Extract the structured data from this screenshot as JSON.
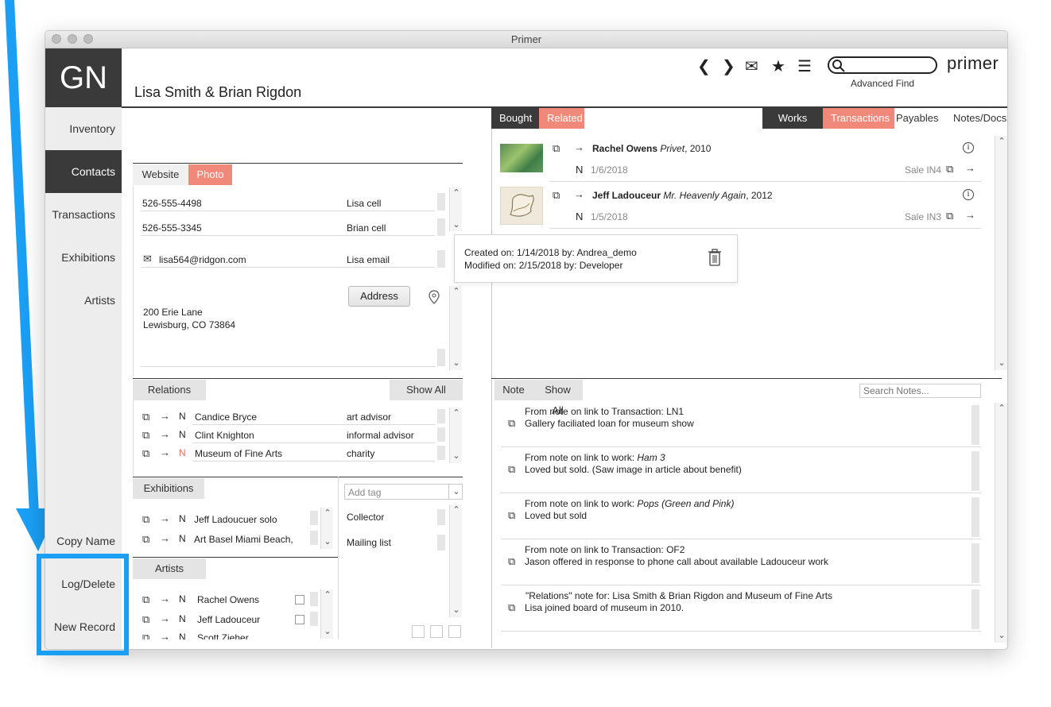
{
  "window": {
    "title": "Primer"
  },
  "logo": {
    "initials": "GN"
  },
  "record": {
    "name": "Lisa Smith & Brian Rigdon"
  },
  "header": {
    "brand": "primer",
    "advanced_find": "Advanced Find",
    "search_value": ""
  },
  "nav": {
    "items": [
      {
        "label": "Inventory"
      },
      {
        "label": "Contacts"
      },
      {
        "label": "Transactions"
      },
      {
        "label": "Exhibitions"
      },
      {
        "label": "Artists"
      }
    ],
    "bottom": {
      "copy_name": "Copy Name",
      "log_delete": "Log/Delete",
      "new_record": "New Record"
    }
  },
  "contact_tabs": {
    "website": "Website",
    "photo": "Photo"
  },
  "phones": [
    {
      "value": "526-555-4498",
      "label": "Lisa cell"
    },
    {
      "value": "526-555-3345",
      "label": "Brian cell"
    }
  ],
  "email": {
    "value": "lisa564@ridgon.com",
    "label": "Lisa email"
  },
  "address": {
    "button": "Address",
    "line1": "200 Erie Lane",
    "line2": "Lewisburg, CO 73864"
  },
  "relations": {
    "title": "Relations",
    "show_all": "Show All",
    "rows": [
      {
        "n": "N",
        "name": "Candice Bryce",
        "role": "art advisor"
      },
      {
        "n": "N",
        "name": "Clint Knighton",
        "role": "informal advisor"
      },
      {
        "n": "N",
        "name": "Museum of Fine Arts",
        "role": "charity"
      }
    ]
  },
  "exhibitions": {
    "title": "Exhibitions",
    "rows": [
      {
        "n": "N",
        "name": "Jeff Ladoucuer solo"
      },
      {
        "n": "N",
        "name": "Art Basel Miami Beach,"
      }
    ]
  },
  "artists": {
    "title": "Artists",
    "rows": [
      {
        "n": "N",
        "name": "Rachel Owens"
      },
      {
        "n": "N",
        "name": "Jeff Ladouceur"
      },
      {
        "n": "N",
        "name": "Scott Zieher"
      }
    ]
  },
  "tags": {
    "placeholder": "Add tag",
    "items": [
      "Collector",
      "Mailing list"
    ]
  },
  "tooltip": {
    "created": "Created on: 1/14/2018 by: Andrea_demo",
    "modified": "Modified on: 2/15/2018 by: Developer"
  },
  "right_tabs": {
    "bought": "Bought",
    "related": "Related",
    "works": "Works",
    "transactions": "Transactions",
    "payables": "Payables",
    "notes_docs": "Notes/Docs"
  },
  "bought": [
    {
      "artist": "Rachel Owens",
      "title": "Privet",
      "year": ", 2010",
      "n": "N",
      "date": "1/6/2018",
      "sale": "Sale IN4"
    },
    {
      "artist": "Jeff Ladouceur",
      "title": "Mr. Heavenly Again",
      "year": ", 2012",
      "n": "N",
      "date": "1/5/2018",
      "sale": "Sale IN3"
    }
  ],
  "notes": {
    "title": "Note",
    "show_all": "Show All",
    "search_placeholder": "Search Notes...",
    "items": [
      {
        "head": "From note on link to Transaction: LN1",
        "head_italic": "",
        "body": "Gallery faciliated loan for museum show"
      },
      {
        "head": "From note on link to work: ",
        "head_italic": "Ham 3",
        "body": "Loved but sold. (Saw image in article about benefit)"
      },
      {
        "head": "From note on link to work: ",
        "head_italic": "Pops (Green and Pink)",
        "body": "Loved but sold"
      },
      {
        "head": "From note on link to Transaction: OF2",
        "head_italic": "",
        "body": "Jason offered in response to phone call about available Ladouceur work"
      },
      {
        "head": "\"Relations\" note for: Lisa Smith & Brian Rigdon and Museum of Fine Arts",
        "head_italic": "",
        "body": "Lisa joined board of museum in 2010."
      }
    ]
  },
  "colors": {
    "accent_salmon": "#f0897a",
    "dark": "#3a3a3a",
    "highlight_blue": "#1a9ff5"
  }
}
